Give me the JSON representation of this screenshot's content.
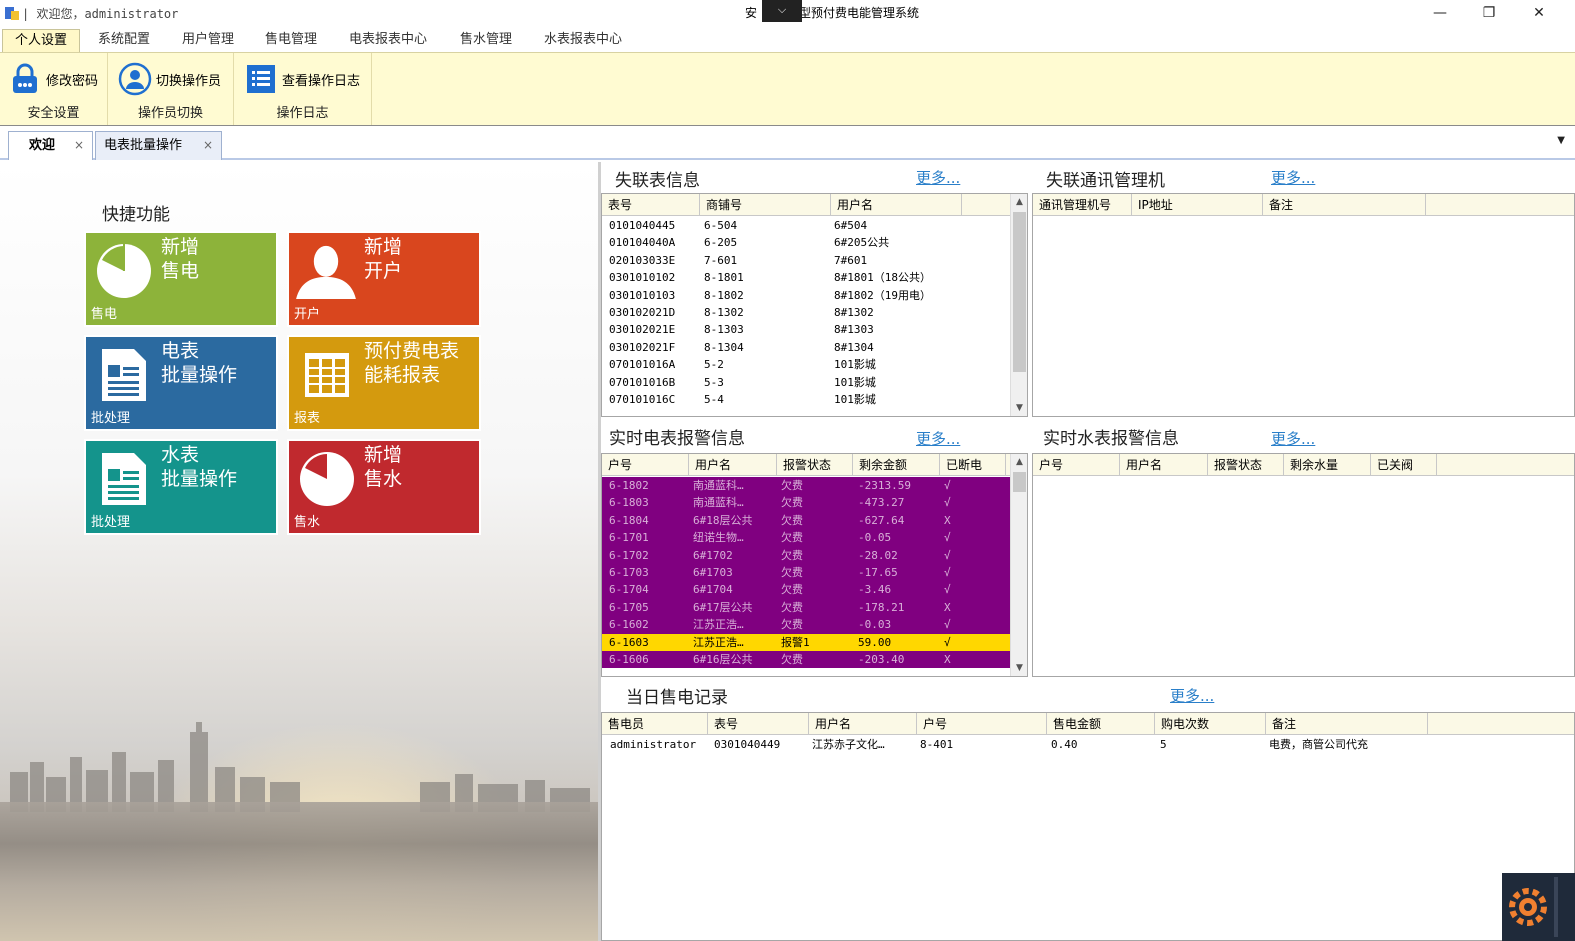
{
  "titlebar": {
    "welcome": "| 欢迎您，administrator",
    "app_title_left": "安",
    "app_title_right": "型预付费电能管理系统",
    "min": "—",
    "max": "❐",
    "close": "✕"
  },
  "menu": [
    {
      "label": "个人设置",
      "active": true
    },
    {
      "label": "系统配置"
    },
    {
      "label": "用户管理"
    },
    {
      "label": "售电管理"
    },
    {
      "label": "电表报表中心"
    },
    {
      "label": "售水管理"
    },
    {
      "label": "水表报表中心"
    }
  ],
  "ribbon": {
    "groups": [
      {
        "button": "修改密码",
        "group": "安全设置",
        "icon": "lock-icon"
      },
      {
        "button": "切换操作员",
        "group": "操作员切换",
        "icon": "user-switch-icon"
      },
      {
        "button": "查看操作日志",
        "group": "操作日志",
        "icon": "log-list-icon"
      }
    ]
  },
  "doctabs": [
    {
      "label": "欢迎",
      "close": "×",
      "active": true
    },
    {
      "label": "电表批量操作",
      "close": "×"
    }
  ],
  "quick": {
    "title": "快捷功能",
    "tiles": [
      {
        "title": "新增\n售电",
        "sub": "售电",
        "color": "#8db33a",
        "icon": "pie-chart-icon"
      },
      {
        "title": "新增\n开户",
        "sub": "开户",
        "color": "#d9461e",
        "icon": "person-icon"
      },
      {
        "title": "电表\n批量操作",
        "sub": "批处理",
        "color": "#2b6aa0",
        "icon": "document-icon"
      },
      {
        "title": "预付费电表\n能耗报表",
        "sub": "报表",
        "color": "#d49a0e",
        "icon": "report-icon"
      },
      {
        "title": "水表\n批量操作",
        "sub": "批处理",
        "color": "#14948c",
        "icon": "document-icon"
      },
      {
        "title": "新增\n售水",
        "sub": "售水",
        "color": "#c0292e",
        "icon": "pie-chart-icon"
      }
    ]
  },
  "lost_meters": {
    "title": "失联表信息",
    "more": "更多...",
    "headers": [
      "表号",
      "商铺号",
      "用户名"
    ],
    "rows": [
      [
        "0101040445",
        "6-504",
        "6#504"
      ],
      [
        "010104040A",
        "6-205",
        "6#205公共"
      ],
      [
        "020103033E",
        "7-601",
        "7#601"
      ],
      [
        "0301010102",
        "8-1801",
        "8#1801（18公共）"
      ],
      [
        "0301010103",
        "8-1802",
        "8#1802（19用电）"
      ],
      [
        "030102021D",
        "8-1302",
        "8#1302"
      ],
      [
        "030102021E",
        "8-1303",
        "8#1303"
      ],
      [
        "030102021F",
        "8-1304",
        "8#1304"
      ],
      [
        "070101016A",
        "5-2",
        "101影城"
      ],
      [
        "070101016B",
        "5-3",
        "101影城"
      ],
      [
        "070101016C",
        "5-4",
        "101影城"
      ]
    ]
  },
  "lost_comm": {
    "title": "失联通讯管理机",
    "more": "更多...",
    "headers": [
      "通讯管理机号",
      "IP地址",
      "备注"
    ]
  },
  "elec_alarm": {
    "title": "实时电表报警信息",
    "more": "更多...",
    "headers": [
      "户号",
      "用户名",
      "报警状态",
      "剩余金额",
      "已断电"
    ],
    "rows": [
      [
        "6-1802",
        "南通蓝科…",
        "欠费",
        "-2313.59",
        "√"
      ],
      [
        "6-1803",
        "南通蓝科…",
        "欠费",
        "-473.27",
        "√"
      ],
      [
        "6-1804",
        "6#18层公共",
        "欠费",
        "-627.64",
        "X"
      ],
      [
        "6-1701",
        "纽诺生物…",
        "欠费",
        "-0.05",
        "√"
      ],
      [
        "6-1702",
        "6#1702",
        "欠费",
        "-28.02",
        "√"
      ],
      [
        "6-1703",
        "6#1703",
        "欠费",
        "-17.65",
        "√"
      ],
      [
        "6-1704",
        "6#1704",
        "欠费",
        "-3.46",
        "√"
      ],
      [
        "6-1705",
        "6#17层公共",
        "欠费",
        "-178.21",
        "X"
      ],
      [
        "6-1602",
        "江苏正浩…",
        "欠费",
        "-0.03",
        "√"
      ],
      [
        "6-1603",
        "江苏正浩…",
        "报警1",
        "59.00",
        "√"
      ],
      [
        "6-1606",
        "6#16层公共",
        "欠费",
        "-203.40",
        "X"
      ]
    ],
    "selected_index": 9
  },
  "water_alarm": {
    "title": "实时水表报警信息",
    "more": "更多...",
    "headers": [
      "户号",
      "用户名",
      "报警状态",
      "剩余水量",
      "已关阀"
    ]
  },
  "sales_today": {
    "title": "当日售电记录",
    "more": "更多...",
    "headers": [
      "售电员",
      "表号",
      "用户名",
      "户号",
      "售电金额",
      "购电次数",
      "备注"
    ],
    "rows": [
      [
        "administrator",
        "0301040449",
        "江苏赤子文化…",
        "8-401",
        "0.40",
        "5",
        "电费，商管公司代充"
      ]
    ]
  },
  "colors": {
    "alarm_row": "#800080",
    "selected_row": "#ffd700",
    "ribbon_bg": "#fffbd2",
    "link": "#2a7fc9"
  }
}
